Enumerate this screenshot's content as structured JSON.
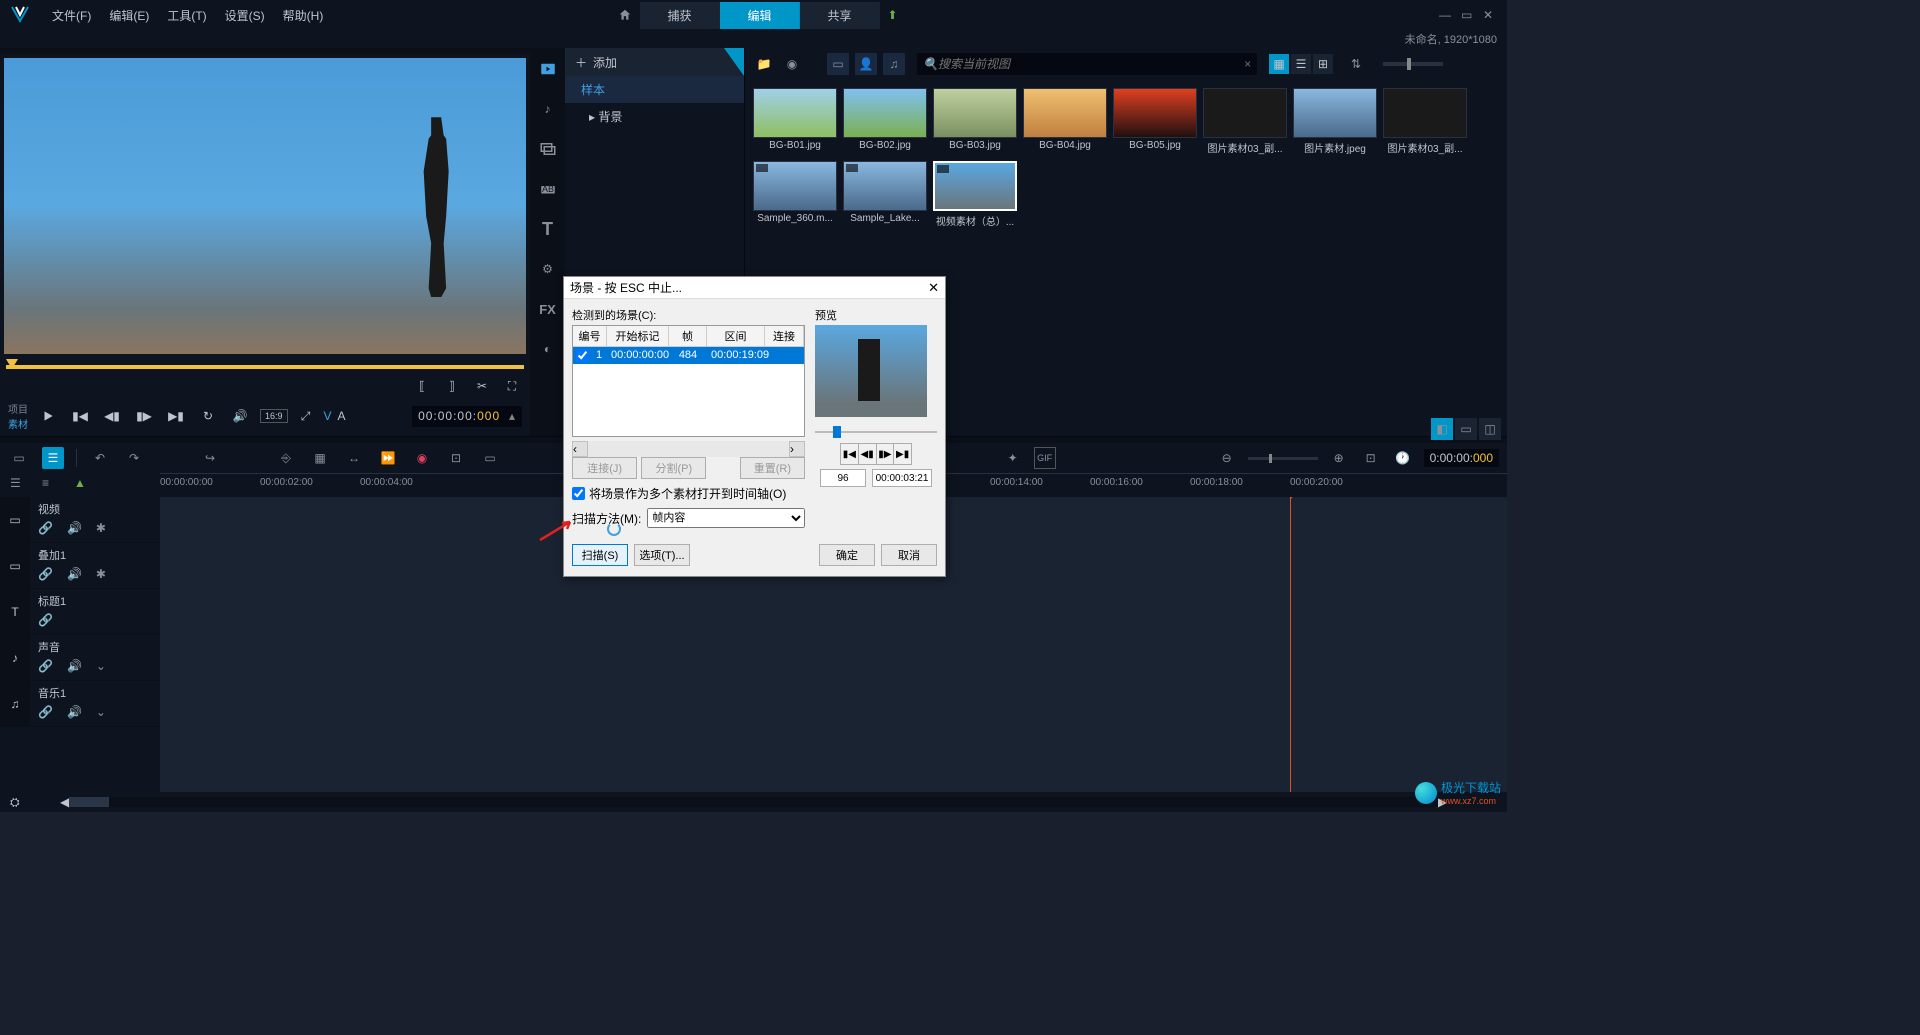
{
  "menubar": {
    "file": "文件(F)",
    "edit": "编辑(E)",
    "tools": "工具(T)",
    "settings": "设置(S)",
    "help": "帮助(H)"
  },
  "tabs": {
    "capture": "捕获",
    "edit": "编辑",
    "share": "共享"
  },
  "titlebar": "未命名, 1920*1080",
  "preview": {
    "src_project": "项目",
    "src_material": "素材",
    "ratio": "16:9",
    "v_label": "V",
    "a_label": "A",
    "timecode_main": "00:00:00:",
    "timecode_frames": "000"
  },
  "library": {
    "add": "添加",
    "tree": {
      "sample": "样本",
      "background": "背景"
    },
    "fx_label": "FX",
    "search_placeholder": "搜索当前视图",
    "thumbs": [
      {
        "label": "BG-B01.jpg"
      },
      {
        "label": "BG-B02.jpg"
      },
      {
        "label": "BG-B03.jpg"
      },
      {
        "label": "BG-B04.jpg"
      },
      {
        "label": "BG-B05.jpg"
      },
      {
        "label": "图片素材03_副..."
      },
      {
        "label": "图片素材.jpeg"
      },
      {
        "label": "图片素材03_副..."
      },
      {
        "label": "Sample_360.m..."
      },
      {
        "label": "Sample_Lake..."
      },
      {
        "label": "视频素材（总）..."
      }
    ]
  },
  "timeline": {
    "tc_main": "0:00:00:",
    "tc_frames": "000",
    "ticks": [
      "00:00:00:00",
      "00:00:02:00",
      "00:00:04:00",
      "00:00:14:00",
      "00:00:16:00",
      "00:00:18:00",
      "00:00:20:00"
    ],
    "tracks": {
      "video": "视频",
      "overlay": "叠加1",
      "title": "标题1",
      "sound": "声音",
      "music": "音乐1"
    }
  },
  "dialog": {
    "title": "场景 - 按 ESC 中止...",
    "detected_label": "检测到的场景(C):",
    "preview_label": "预览",
    "headers": {
      "num": "编号",
      "start": "开始标记",
      "frames": "帧",
      "duration": "区间",
      "join": "连接"
    },
    "row": {
      "num": "1",
      "start": "00:00:00:00",
      "frames": "484",
      "duration": "00:00:19:09"
    },
    "btn_join": "连接(J)",
    "btn_split": "分割(P)",
    "btn_reset": "重置(R)",
    "checkbox": "将场景作为多个素材打开到时间轴(O)",
    "scan_method_label": "扫描方法(M):",
    "scan_method_value": "帧内容",
    "btn_scan": "扫描(S)",
    "btn_options": "选项(T)...",
    "btn_ok": "确定",
    "btn_cancel": "取消",
    "preview_num": "96",
    "preview_tc": "00:00:03:21"
  },
  "watermark": {
    "name": "极光下载站",
    "url": "www.xz7.com"
  }
}
